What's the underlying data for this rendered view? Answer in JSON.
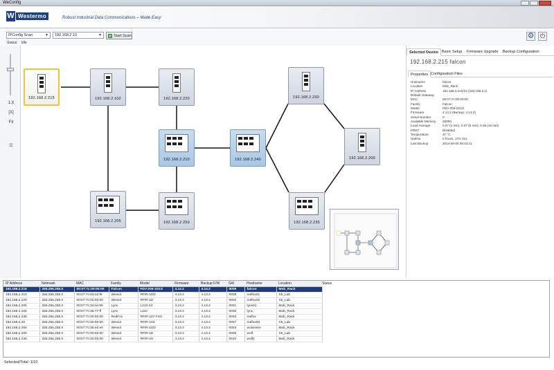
{
  "window": {
    "title": "WeConfig"
  },
  "banner": {
    "logo_letter": "W",
    "logo_text": "Westermo",
    "tagline": "Robust Industrial Data Communications – Made Easy"
  },
  "toolbar": {
    "scan_mode": "IPConfig Scan",
    "ip": "192.168.2.10",
    "start_scan": "Start Scan",
    "status_label": "Status:",
    "status_value": "Idle"
  },
  "left_tools": [
    "1:X",
    "[X]",
    "Fit",
    "☷"
  ],
  "network": {
    "nodes": [
      {
        "label": "192.168.2.215",
        "kind": "slim",
        "state": "selected"
      },
      {
        "label": "192.168.2.102",
        "kind": "slim",
        "state": "normal"
      },
      {
        "label": "192.168.2.220",
        "kind": "slim",
        "state": "normal"
      },
      {
        "label": "192.168.2.210",
        "kind": "wide",
        "state": "highlight"
      },
      {
        "label": "192.168.2.240",
        "kind": "wide",
        "state": "highlight"
      },
      {
        "label": "192.168.2.230",
        "kind": "slim",
        "state": "normal"
      },
      {
        "label": "192.168.2.200",
        "kind": "slim",
        "state": "normal"
      },
      {
        "label": "192.168.2.205",
        "kind": "wide",
        "state": "normal"
      },
      {
        "label": "192.168.2.250",
        "kind": "wide",
        "state": "normal"
      },
      {
        "label": "192.168.2.235",
        "kind": "wide",
        "state": "normal"
      }
    ]
  },
  "panel": {
    "tabs": [
      "Selected Device",
      "Basic Setup",
      "Firmware Upgrade",
      "Backup Configuration"
    ],
    "selected_title": "192.168.2.215  falcon",
    "subtabs": [
      "Properties",
      "Configuration Files"
    ],
    "properties": [
      {
        "key": "Hostname",
        "value": "falcon"
      },
      {
        "key": "Location",
        "value": "Mob_Rack"
      },
      {
        "key": "IP Address",
        "value": "192.168.2.215/24 (192.168.2.1)"
      },
      {
        "key": "Default Gateway",
        "value": ""
      },
      {
        "key": "MAC",
        "value": "00:07:7c:00:00:00"
      },
      {
        "key": "Family",
        "value": "Falcon"
      },
      {
        "key": "Model",
        "value": "FDV-206-1D1S"
      },
      {
        "key": "Firmware",
        "value": "4.14.2 (Backup: 4.14.2)"
      },
      {
        "key": "Serial Number",
        "value": "0"
      },
      {
        "key": "Available Memory",
        "value": "26000"
      },
      {
        "key": "Load Average",
        "value": "0.07 (1 min), 0.07 (5 min), 0.05 (15 min)"
      },
      {
        "key": "FRNT",
        "value": "Disabled"
      },
      {
        "key": "Temperature",
        "value": "37 °C"
      },
      {
        "key": "Uptime",
        "value": "0 hours, 17m 31s"
      },
      {
        "key": "Last Backup",
        "value": "2014-06-06 06:43:21"
      }
    ]
  },
  "table": {
    "columns": [
      "IP Address",
      "Netmask",
      "MAC",
      "Family",
      "Model",
      "Firmware",
      "Backup F/W",
      "SAI",
      "Hostname",
      "Location"
    ],
    "status_header": "Status",
    "rows": [
      [
        "192.168.2.215",
        "255.255.255.0",
        "00:07:7c:00:00:00",
        "Falcon",
        "FDV-206-1D1S",
        "4.14.2",
        "4.14.2",
        "0009",
        "falcon",
        "Mob_Rack"
      ],
      [
        "192.168.2.210",
        "255.255.255.0",
        "00:07:7c:03:a2:f9",
        "Weos4",
        "RFIR-1DD",
        "4.13.4",
        "4.13.4",
        "0008",
        "redfox01",
        "S5_Lab"
      ],
      [
        "192.168.2.220",
        "255.255.255.0",
        "00:07:7c:00:00:00",
        "Weos4",
        "RFIR-1D",
        "4.13.4",
        "4.13.4",
        "0002",
        "redfox02",
        "S5_Lab"
      ],
      [
        "192.168.2.205",
        "255.255.255.0",
        "00:07:7c:0d:ce:96",
        "Lynx",
        "L210-S2",
        "4.13.4",
        "4.13.4",
        "0001",
        "lynx01",
        "Mob_Rack"
      ],
      [
        "192.168.2.102",
        "255.255.255.0",
        "00:07:7c:05:77:ff",
        "Lynx",
        "L110",
        "4.13.4",
        "4.13.4",
        "0005",
        "lynx",
        "Mob_Rack"
      ],
      [
        "192.168.2.235",
        "255.255.255.0",
        "00:07:7c:00:00:00",
        "RedFox",
        "RFIR-227-F4G",
        "4.13.4",
        "4.13.4",
        "0003",
        "redfox",
        "Mob_Rack"
      ],
      [
        "192.168.2.40",
        "255.255.255.0",
        "00:07:7c:00:00:00",
        "Weos4",
        "RFIR-22S",
        "4.13.4",
        "4.13.4",
        "0007",
        "redfox03",
        "S5_Lab"
      ],
      [
        "192.168.2.250",
        "255.255.255.0",
        "00:07:7c:05:e0:e0",
        "Weos4",
        "RFIR-1DD",
        "4.13.4",
        "4.13.4",
        "0004",
        "wolverine",
        "Mob_Rack"
      ],
      [
        "192.168.2.200",
        "255.255.255.0",
        "00:07:7c:00:00:00",
        "Weos4",
        "RFIR-1D",
        "4.13.4",
        "4.13.4",
        "0006",
        "wolf",
        "S5_Lab"
      ],
      [
        "192.168.2.230",
        "255.255.255.0",
        "00:07:7c:00:00:00",
        "Weos4",
        "RFIR-2S",
        "4.13.4",
        "4.13.4",
        "0010",
        "wolf2",
        "Mob_Rack"
      ]
    ]
  },
  "footer": {
    "text": "Selected/Total: 1/10"
  },
  "colors": {
    "selection": "#1e3c7c",
    "selected_node_border": "#f0c23c",
    "highlight_node": "#a9c8e6",
    "brand": "#1d3f86"
  }
}
